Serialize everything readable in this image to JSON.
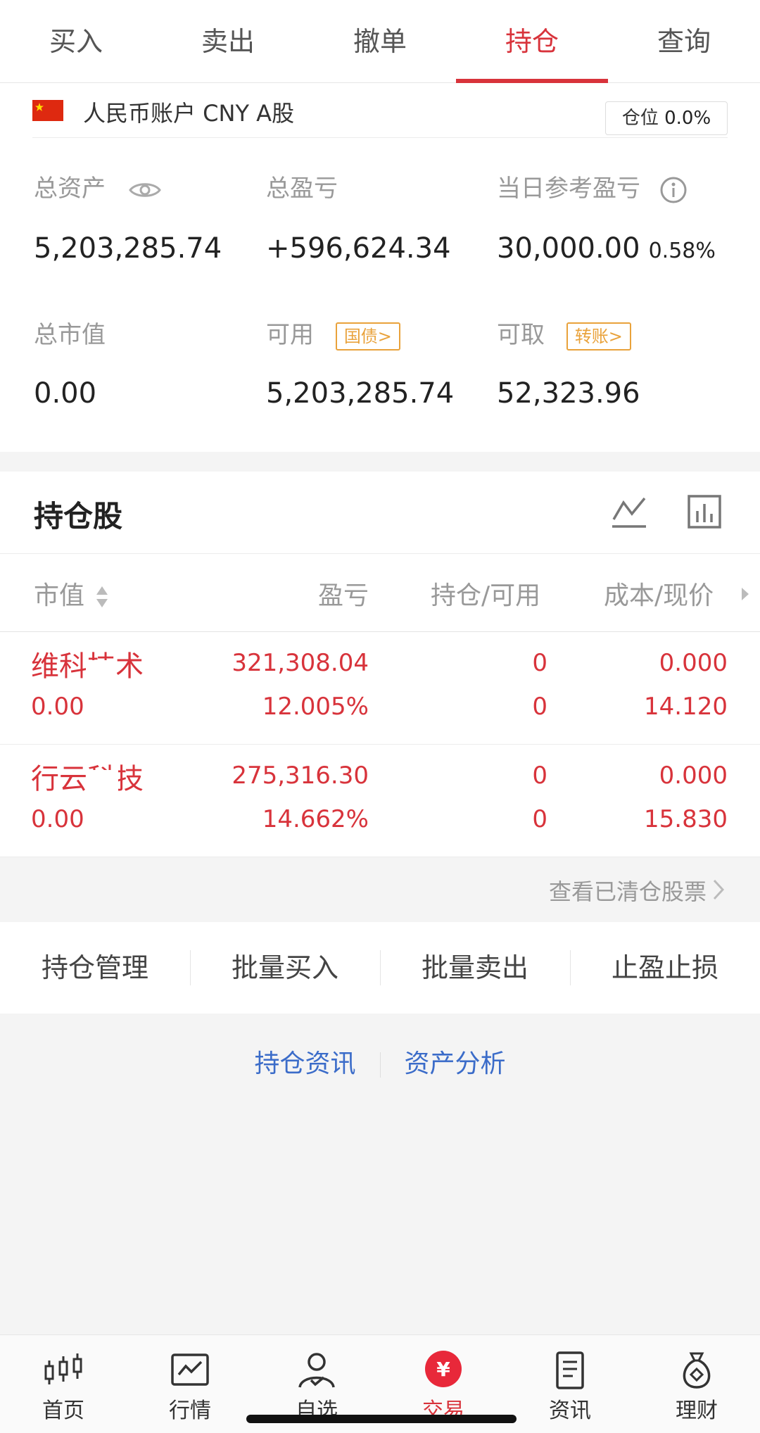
{
  "tabs": [
    {
      "label": "买入"
    },
    {
      "label": "卖出"
    },
    {
      "label": "撤单"
    },
    {
      "label": "持仓"
    },
    {
      "label": "查询"
    }
  ],
  "account": {
    "name": "人民币账户 CNY A股",
    "position_label": "仓位",
    "position_value": "0.0%"
  },
  "metrics": {
    "total_assets_label": "总资产",
    "total_assets_value": "5,203,285.74",
    "total_pnl_label": "总盈亏",
    "total_pnl_value": "+596,624.34",
    "daily_pnl_label": "当日参考盈亏",
    "daily_pnl_value": "30,000.00",
    "daily_pnl_pct": "0.58%",
    "market_value_label": "总市值",
    "market_value_value": "0.00",
    "available_label": "可用",
    "available_tag": "国债>",
    "available_value": "5,203,285.74",
    "withdrawable_label": "可取",
    "withdrawable_tag": "转账>",
    "withdrawable_value": "52,323.96"
  },
  "holdings": {
    "title": "持仓股",
    "columns": {
      "market_value": "市值",
      "pnl": "盈亏",
      "position": "持仓/可用",
      "cost": "成本/现价"
    },
    "rows": [
      {
        "name": "维科技术",
        "market_value": "0.00",
        "pnl": "321,308.04",
        "pnl_pct": "12.005%",
        "position": "0",
        "available": "0",
        "cost": "0.000",
        "price": "14.120"
      },
      {
        "name": "行云科技",
        "market_value": "0.00",
        "pnl": "275,316.30",
        "pnl_pct": "14.662%",
        "position": "0",
        "available": "0",
        "cost": "0.000",
        "price": "15.830"
      }
    ],
    "cleared_link": "查看已清仓股票"
  },
  "actions": [
    {
      "label": "持仓管理"
    },
    {
      "label": "批量买入"
    },
    {
      "label": "批量卖出"
    },
    {
      "label": "止盈止损"
    }
  ],
  "links": {
    "news": "持仓资讯",
    "analysis": "资产分析"
  },
  "bottom_nav": [
    {
      "label": "首页",
      "icon": "candlestick-icon"
    },
    {
      "label": "行情",
      "icon": "chart-icon"
    },
    {
      "label": "自选",
      "icon": "person-check-icon"
    },
    {
      "label": "交易",
      "icon": "yuan-icon"
    },
    {
      "label": "资讯",
      "icon": "document-icon"
    },
    {
      "label": "理财",
      "icon": "money-bag-icon"
    }
  ],
  "colors": {
    "accent": "#d8333b",
    "link": "#3b6cc9",
    "tag": "#e9a23b"
  }
}
